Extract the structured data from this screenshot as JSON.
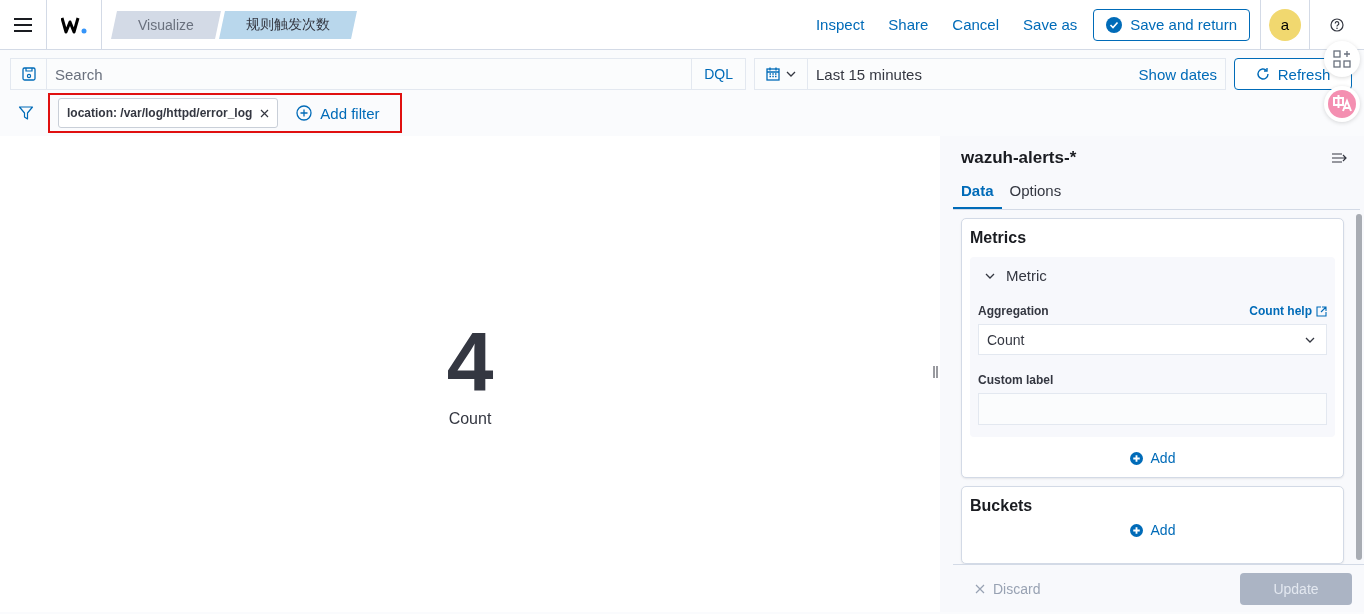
{
  "header": {
    "breadcrumbs": [
      {
        "label": "Visualize",
        "selected": false
      },
      {
        "label": "规则触发次数",
        "selected": true
      }
    ],
    "actions": [
      "Inspect",
      "Share",
      "Cancel",
      "Save as"
    ],
    "primary_action": "Save and return",
    "avatar": "a"
  },
  "query_bar": {
    "placeholder": "Search",
    "language": "DQL",
    "time_range": "Last 15 minutes",
    "show_dates": "Show dates",
    "refresh": "Refresh"
  },
  "filters": [
    {
      "label": "location: /var/log/httpd/error_log"
    }
  ],
  "add_filter": "Add filter",
  "metric": {
    "value": "4",
    "label": "Count"
  },
  "sidebar": {
    "index_pattern": "wazuh-alerts-*",
    "tabs": [
      {
        "label": "Data",
        "selected": true
      },
      {
        "label": "Options",
        "selected": false
      }
    ],
    "metrics": {
      "title": "Metrics",
      "item": {
        "title": "Metric",
        "expanded": true,
        "aggregation_label": "Aggregation",
        "help_link": "Count help",
        "aggregation_value": "Count",
        "custom_label": "Custom label"
      },
      "add": "Add"
    },
    "buckets": {
      "title": "Buckets",
      "add": "Add"
    },
    "discard": "Discard",
    "update": {
      "label": "Update",
      "disabled": true
    }
  }
}
